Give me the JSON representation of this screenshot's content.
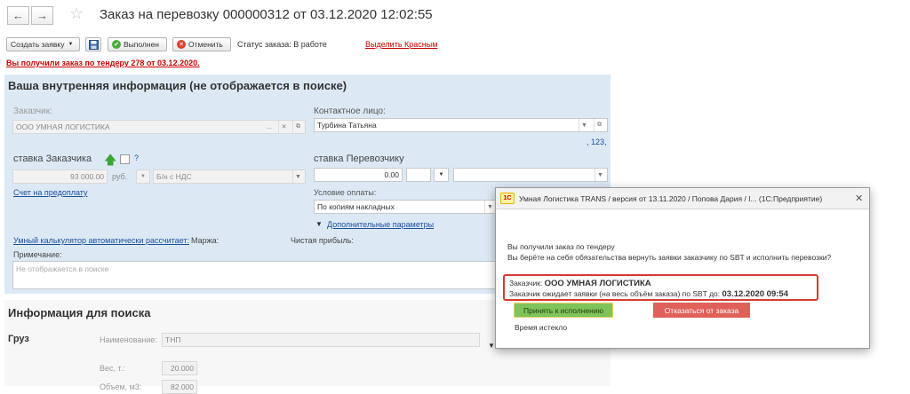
{
  "header": {
    "back_glyph": "←",
    "forward_glyph": "→",
    "star_glyph": "☆",
    "title": "Заказ на перевозку 000000312 от 03.12.2020 12:02:55"
  },
  "toolbar": {
    "create_order": "Создать заявку",
    "done": "Выполнен",
    "cancel": "Отменить",
    "status": "Статус заказа: В работе",
    "highlight_red": "Выделить Красным"
  },
  "tender_notice": "Вы получили заказ по тендеру 278 от 03.12.2020.",
  "internal": {
    "title": "Ваша внутренняя информация (не отображается в поиске)",
    "customer_label": "Заказчик:",
    "customer_value": "ООО УМНАЯ ЛОГИСТИКА",
    "contact_label": "Контактное лицо:",
    "contact_value": "Турбина Татьяна",
    "contact_extra": ", 123,",
    "customer_rate_label": "ставка Заказчика",
    "question": "?",
    "customer_rate_value": "93 000.00",
    "currency": "руб.",
    "vat": "Б/н с НДС",
    "carrier_rate_label": "ставка Перевозчику",
    "carrier_rate_value": "0.00",
    "prepay_invoice": "Счет на предоплату",
    "payment_terms_label": "Условие оплаты:",
    "payment_terms_value": "По копиям накладных",
    "additional_params": "Дополнительные параметры",
    "calculator": "Умный калькулятор автоматически рассчитает:",
    "margin": "Маржа:",
    "net_profit": "Чистая прибыль:",
    "note_label": "Примечание:",
    "note_placeholder": "Не отображается в поиске"
  },
  "search_info": {
    "title": "Информация для поиска",
    "cargo": "Груз",
    "name_label": "Наименование:",
    "name_value": "ТНП",
    "weight_label": "Вес, т.:",
    "weight_value": "20.000",
    "volume_label": "Объем, м3:",
    "volume_value": "82.000"
  },
  "dialog": {
    "logo": "1С",
    "title": "Умная Логистика TRANS / версия от 13.11.2020 / Попова Дария / I... (1С:Предприятие)",
    "close": "✕",
    "line1": "Вы получили заказ по тендеру",
    "line2": "Вы берёте на себя обязательства вернуть заявки заказчику по SBT и исполнить перевозки?",
    "customer_prefix": "Заказчик:",
    "customer_name": "ООО УМНАЯ ЛОГИСТИКА",
    "waiting_text": "Заказчик ожидает заявки (на весь объём заказа) по SBT до:",
    "deadline": "03.12.2020 09:54",
    "accept": "Принять к исполнению",
    "refuse": "Отказаться от заказа",
    "expired": "Время истекло"
  },
  "colors": {
    "panel_bg": "#dce9f5",
    "red": "#cc0000",
    "accept_bg": "#7fc35a",
    "refuse_bg": "#e0605a",
    "link": "#1a4f9c"
  }
}
